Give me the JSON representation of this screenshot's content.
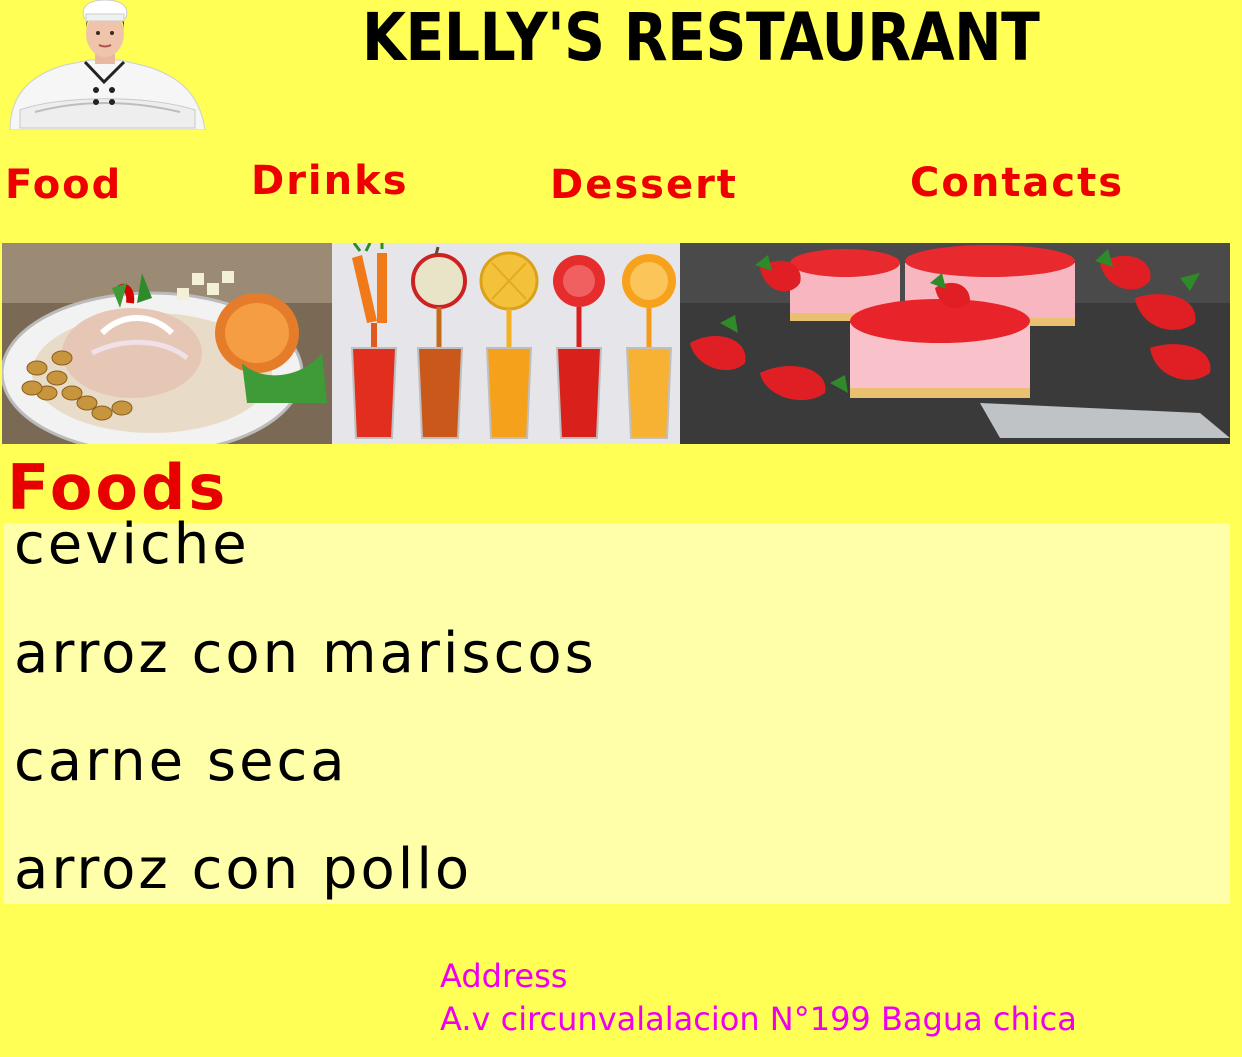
{
  "header": {
    "title": "KELLY'S RESTAURANT",
    "logo_image": "chef-portrait"
  },
  "nav": {
    "items": [
      {
        "label": "Food"
      },
      {
        "label": "Drinks"
      },
      {
        "label": "Dessert"
      },
      {
        "label": "Contacts"
      }
    ]
  },
  "banner": {
    "images": [
      "ceviche-plate",
      "fruit-juices",
      "strawberry-cheesecake"
    ]
  },
  "menu": {
    "title": "Foods",
    "items": [
      "ceviche",
      "arroz con mariscos",
      "carne seca",
      "arroz con pollo"
    ]
  },
  "footer": {
    "address_label": "Address",
    "address_value": "A.v circunvalalacion N°199 Bagua chica"
  },
  "colors": {
    "page_background": "#ffff55",
    "menu_background": "#ffffaa",
    "nav_text": "#ee0000",
    "section_title": "#e80000",
    "footer_text": "#ee00ee"
  }
}
